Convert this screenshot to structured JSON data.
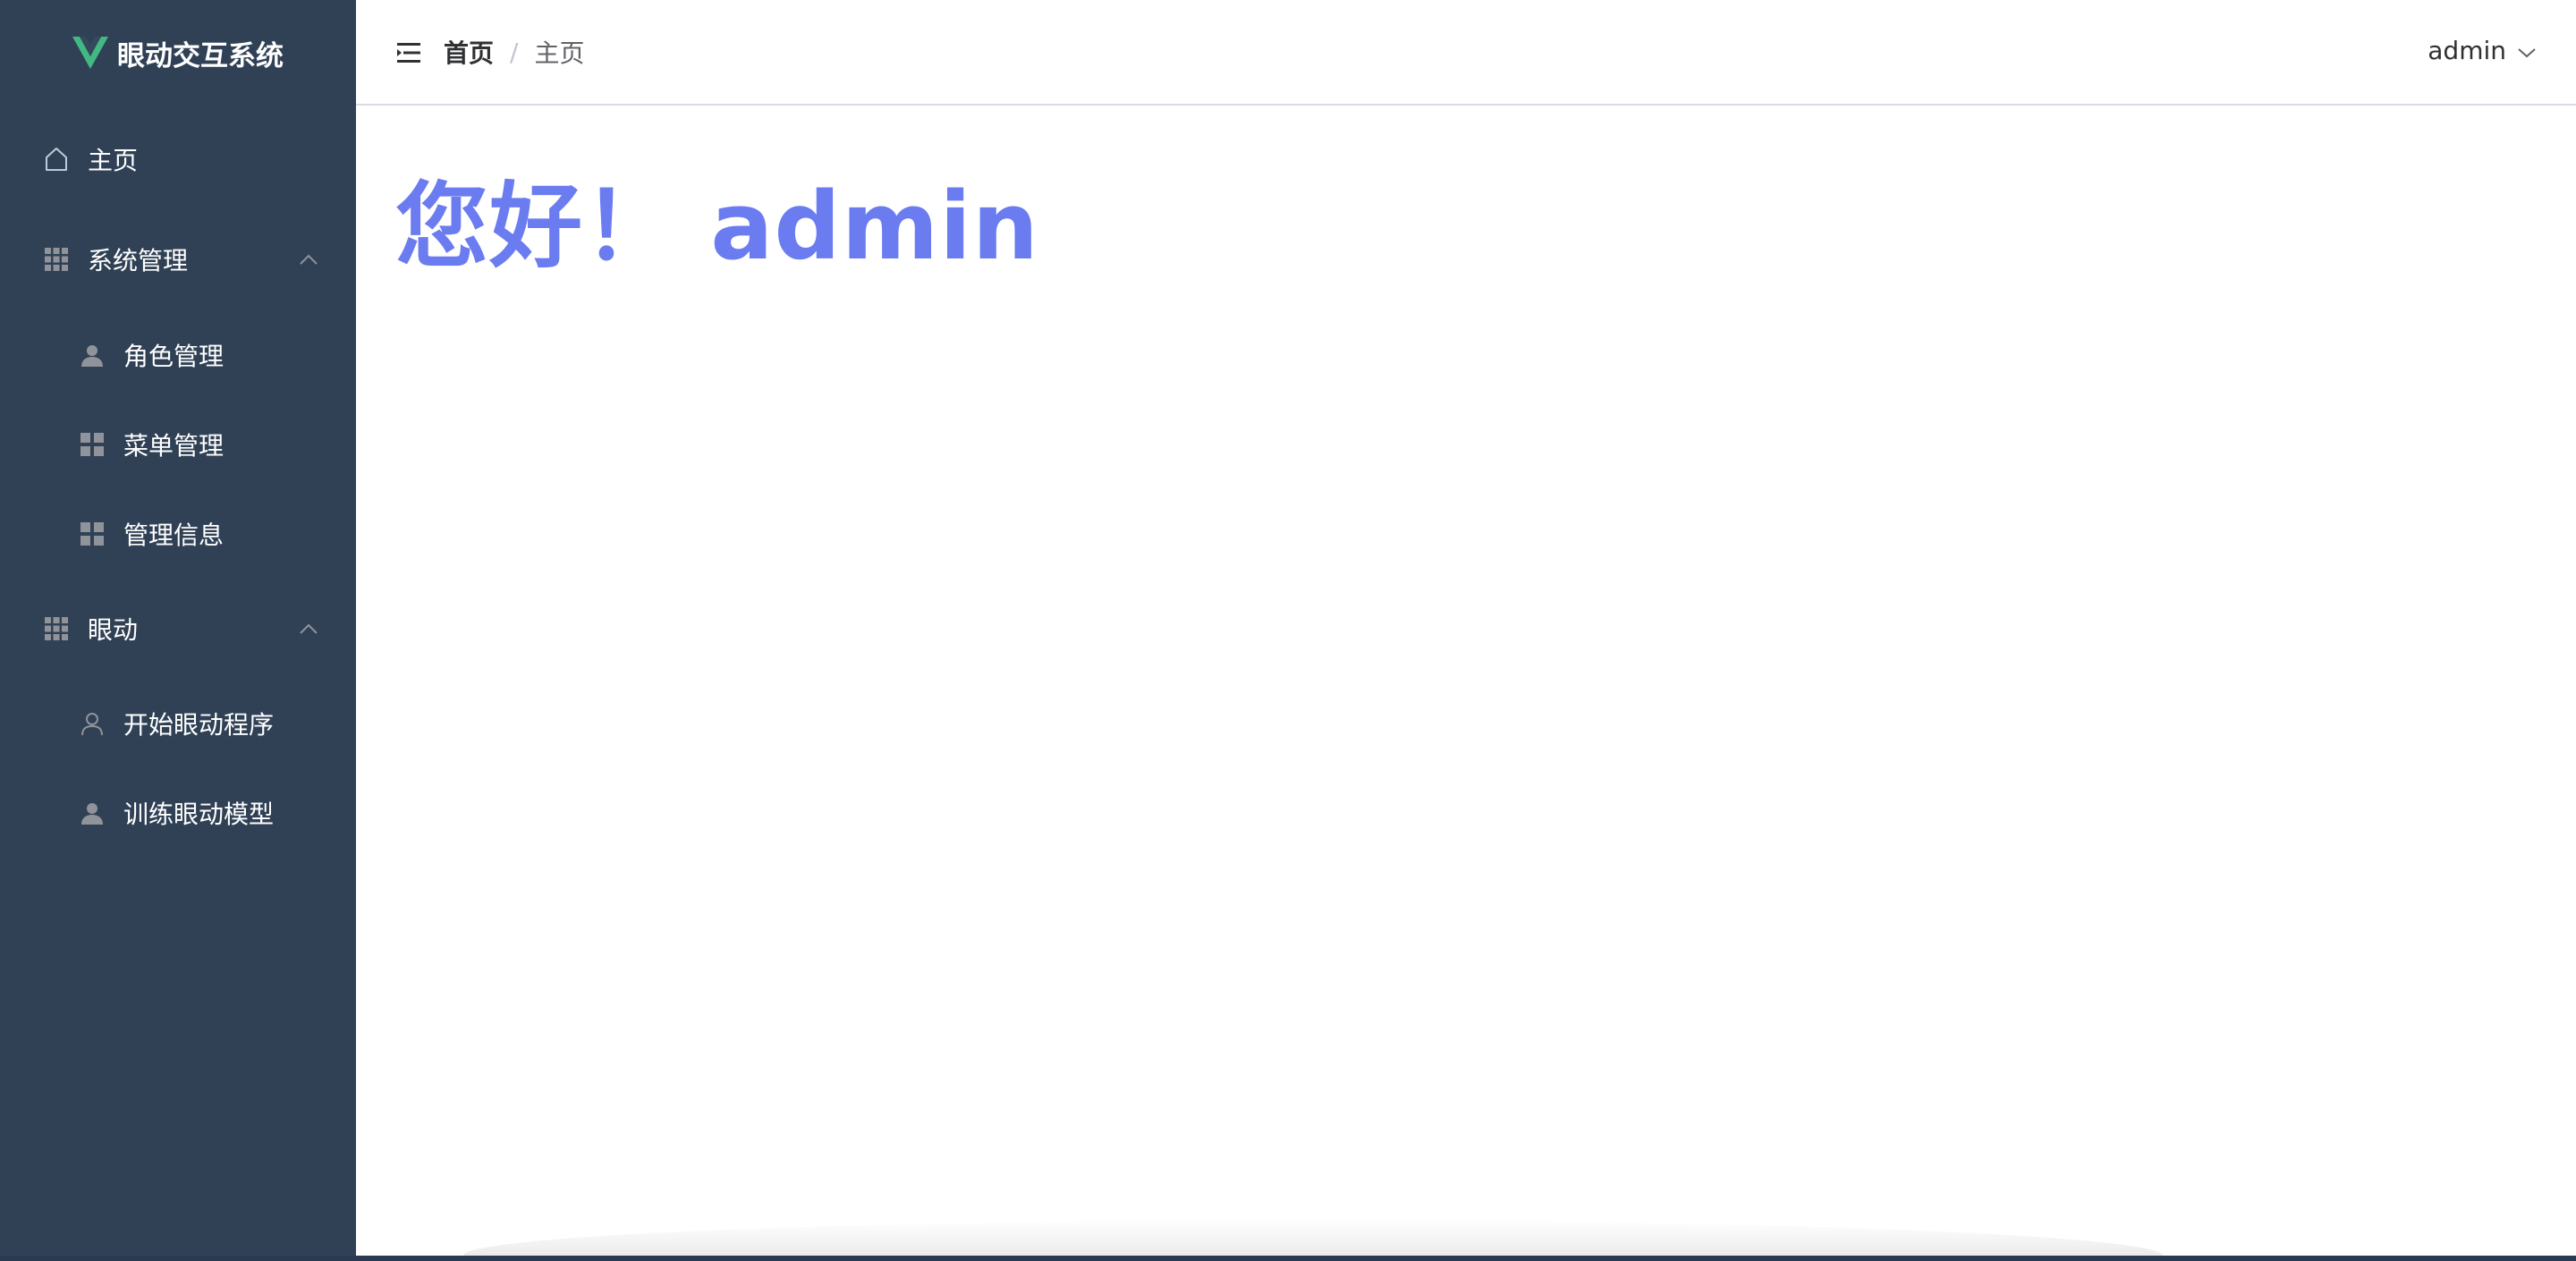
{
  "sidebar": {
    "logo_text": "眼动交互系统",
    "logo_color": "#42b983",
    "background": "#304156",
    "items": [
      {
        "label": "主页",
        "icon": "home-icon",
        "level": 1
      },
      {
        "label": "系统管理",
        "icon": "grid-icon",
        "level": 1,
        "expanded": true
      },
      {
        "label": "角色管理",
        "icon": "user-filled-icon",
        "level": 2
      },
      {
        "label": "菜单管理",
        "icon": "tiles-icon",
        "level": 2
      },
      {
        "label": "管理信息",
        "icon": "tiles-icon",
        "level": 2
      },
      {
        "label": "眼动",
        "icon": "grid-icon",
        "level": 1,
        "expanded": true
      },
      {
        "label": "开始眼动程序",
        "icon": "user-outline-icon",
        "level": 2
      },
      {
        "label": "训练眼动模型",
        "icon": "user-filled-icon",
        "level": 2
      }
    ]
  },
  "navbar": {
    "breadcrumb": {
      "home": "首页",
      "separator": "/",
      "current": "主页"
    },
    "user": "admin"
  },
  "main": {
    "greeting": "您好！ admin",
    "greeting_color": "#6b7cf0"
  }
}
